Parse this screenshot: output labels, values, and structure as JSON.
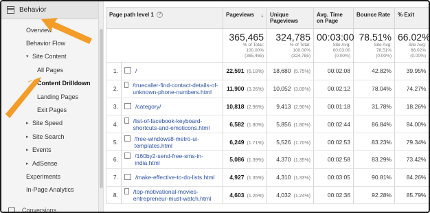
{
  "sidebar": {
    "header": "Behavior",
    "items": [
      {
        "label": "Overview",
        "level": 1,
        "toggle": ""
      },
      {
        "label": "Behavior Flow",
        "level": 1,
        "toggle": ""
      },
      {
        "label": "Site Content",
        "level": 1,
        "toggle": "▾"
      },
      {
        "label": "All Pages",
        "level": 2,
        "toggle": ""
      },
      {
        "label": "Content Drilldown",
        "level": 2,
        "toggle": "",
        "active": true
      },
      {
        "label": "Landing Pages",
        "level": 2,
        "toggle": ""
      },
      {
        "label": "Exit Pages",
        "level": 2,
        "toggle": ""
      },
      {
        "label": "Site Speed",
        "level": 1,
        "toggle": "▸"
      },
      {
        "label": "Site Search",
        "level": 1,
        "toggle": "▸"
      },
      {
        "label": "Events",
        "level": 1,
        "toggle": "▸"
      },
      {
        "label": "AdSense",
        "level": 1,
        "toggle": "▸"
      },
      {
        "label": "Experiments",
        "level": 1,
        "toggle": ""
      },
      {
        "label": "In-Page Analytics",
        "level": 1,
        "toggle": ""
      }
    ],
    "bottom_label": "Conversions"
  },
  "table": {
    "headers": {
      "page_path": "Page path level 1",
      "pageviews": "Pageviews",
      "unique_pageviews": "Unique Pageviews",
      "avg_time": "Avg. Time on Page",
      "bounce_rate": "Bounce Rate",
      "exit": "% Exit"
    },
    "summary": {
      "pageviews": {
        "value": "365,465",
        "line1": "% of Total:",
        "line2": "100.00%",
        "line3": "(365,465)"
      },
      "unique_pageviews": {
        "value": "324,785",
        "line1": "% of Total:",
        "line2": "100.00%",
        "line3": "(324,785)"
      },
      "avg_time": {
        "value": "00:03:00",
        "line1": "Site Avg:",
        "line2": "00:03:00",
        "line3": "(0.00%)"
      },
      "bounce_rate": {
        "value": "78.51%",
        "line1": "Site Avg:",
        "line2": "78.51%",
        "line3": "(0.00%)"
      },
      "exit": {
        "value": "66.02%",
        "line1": "Site Avg:",
        "line2": "66.02%",
        "line3": "(0.00%)"
      }
    },
    "rows": [
      {
        "no": "1.",
        "path": "/",
        "pv": "22,591",
        "pv_pct": "(6.18%)",
        "upv": "18,680",
        "upv_pct": "(5.75%)",
        "time": "00:02:08",
        "bounce": "42.82%",
        "exit": "39.95%"
      },
      {
        "no": "2.",
        "path": "/truecaller-find-contact-details-of-unknown-phone-numbers.html",
        "pv": "11,900",
        "pv_pct": "(3.26%)",
        "upv": "10,052",
        "upv_pct": "(3.09%)",
        "time": "00:02:12",
        "bounce": "78.04%",
        "exit": "74.27%"
      },
      {
        "no": "3.",
        "path": "/category/",
        "pv": "10,818",
        "pv_pct": "(2.96%)",
        "upv": "9,413",
        "upv_pct": "(2.90%)",
        "time": "00:01:18",
        "bounce": "31.78%",
        "exit": "18.26%"
      },
      {
        "no": "4.",
        "path": "/list-of-facebook-keyboard-shortcuts-and-emoticons.html",
        "pv": "6,582",
        "pv_pct": "(1.80%)",
        "upv": "5,856",
        "upv_pct": "(1.80%)",
        "time": "00:02:44",
        "bounce": "86.84%",
        "exit": "84.00%"
      },
      {
        "no": "5.",
        "path": "/free-windows8-metro-ui-templates.html",
        "pv": "6,249",
        "pv_pct": "(1.71%)",
        "upv": "5,526",
        "upv_pct": "(1.70%)",
        "time": "00:02:53",
        "bounce": "83.23%",
        "exit": "79.34%"
      },
      {
        "no": "6.",
        "path": "/160by2-send-free-sms-in-india.html",
        "pv": "5,086",
        "pv_pct": "(1.39%)",
        "upv": "4,370",
        "upv_pct": "(1.35%)",
        "time": "00:02:58",
        "bounce": "83.29%",
        "exit": "73.42%"
      },
      {
        "no": "7.",
        "path": "/make-effective-to-do-lists.html",
        "pv": "4,927",
        "pv_pct": "(1.35%)",
        "upv": "4,310",
        "upv_pct": "(1.33%)",
        "time": "00:03:05",
        "bounce": "90.81%",
        "exit": "84.26%"
      },
      {
        "no": "8.",
        "path": "/top-motivational-movies-entrepreneur-must-watch.html",
        "pv": "4,603",
        "pv_pct": "(1.26%)",
        "upv": "4,032",
        "upv_pct": "(1.24%)",
        "time": "00:02:36",
        "bounce": "92.28%",
        "exit": "85.79%"
      }
    ]
  },
  "colors": {
    "arrow": "#f39c28",
    "link": "#2a4fa1"
  }
}
